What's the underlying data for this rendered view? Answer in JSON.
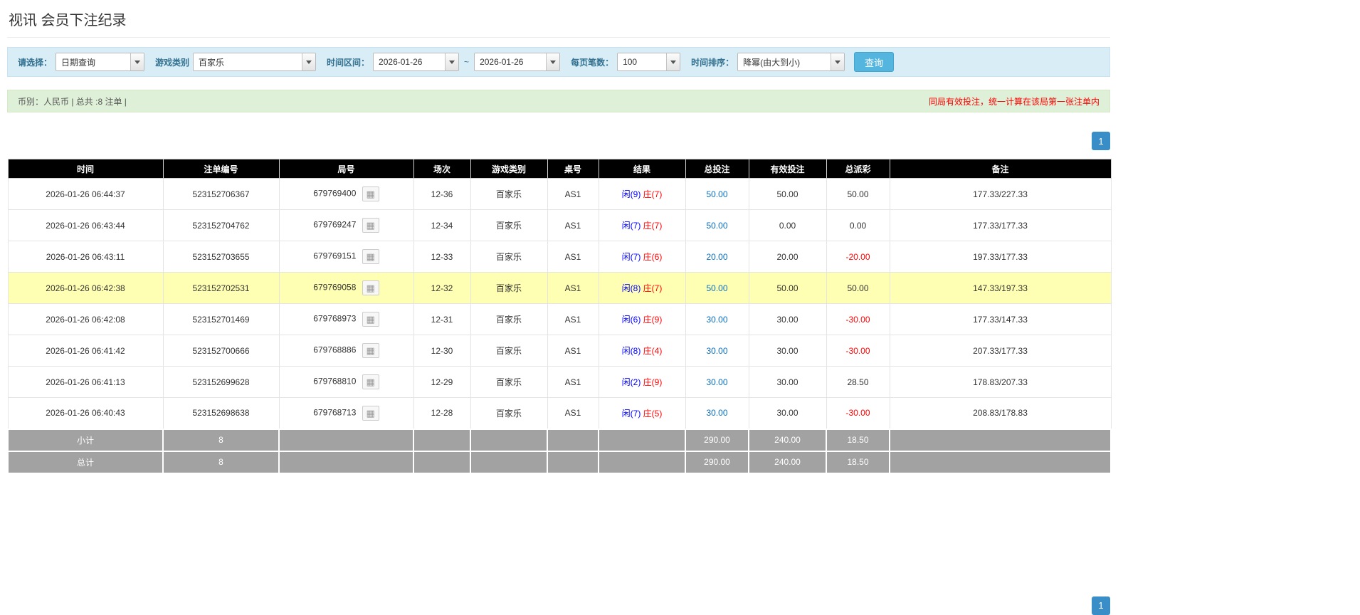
{
  "page": {
    "title": "视讯 会员下注纪录"
  },
  "filter": {
    "select_label": "请选择：",
    "select_value": "日期查询",
    "game_label": "游戏类别",
    "game_value": "百家乐",
    "range_label": "时间区间：",
    "date_from": "2026-01-26",
    "tilde": "~",
    "date_to": "2026-01-26",
    "per_page_label": "每页笔数：",
    "per_page_value": "100",
    "sort_label": "时间排序：",
    "sort_value": "降幂(由大到小)",
    "search_button": "查询"
  },
  "summary": {
    "left": "币别：人民币 | 总共 :8 注单 |",
    "right": "同局有效投注，统一计算在该局第一张注单内"
  },
  "pagination": {
    "page": "1"
  },
  "table": {
    "headers": [
      "时间",
      "注单编号",
      "局号",
      "场次",
      "游戏类别",
      "桌号",
      "结果",
      "总投注",
      "有效投注",
      "总派彩",
      "备注"
    ],
    "rows": [
      {
        "time": "2026-01-26 06:44:37",
        "bet_id": "523152706367",
        "round": "679769400",
        "session": "12-36",
        "game": "百家乐",
        "table": "AS1",
        "player": "闲(9)",
        "banker": "庄(7)",
        "total_bet": "50.00",
        "valid_bet": "50.00",
        "payout": "50.00",
        "payout_neg": false,
        "note": "177.33/227.33",
        "highlight": false
      },
      {
        "time": "2026-01-26 06:43:44",
        "bet_id": "523152704762",
        "round": "679769247",
        "session": "12-34",
        "game": "百家乐",
        "table": "AS1",
        "player": "闲(7)",
        "banker": "庄(7)",
        "total_bet": "50.00",
        "valid_bet": "0.00",
        "payout": "0.00",
        "payout_neg": false,
        "note": "177.33/177.33",
        "highlight": false
      },
      {
        "time": "2026-01-26 06:43:11",
        "bet_id": "523152703655",
        "round": "679769151",
        "session": "12-33",
        "game": "百家乐",
        "table": "AS1",
        "player": "闲(7)",
        "banker": "庄(6)",
        "total_bet": "20.00",
        "valid_bet": "20.00",
        "payout": "-20.00",
        "payout_neg": true,
        "note": "197.33/177.33",
        "highlight": false
      },
      {
        "time": "2026-01-26 06:42:38",
        "bet_id": "523152702531",
        "round": "679769058",
        "session": "12-32",
        "game": "百家乐",
        "table": "AS1",
        "player": "闲(8)",
        "banker": "庄(7)",
        "total_bet": "50.00",
        "valid_bet": "50.00",
        "payout": "50.00",
        "payout_neg": false,
        "note": "147.33/197.33",
        "highlight": true
      },
      {
        "time": "2026-01-26 06:42:08",
        "bet_id": "523152701469",
        "round": "679768973",
        "session": "12-31",
        "game": "百家乐",
        "table": "AS1",
        "player": "闲(6)",
        "banker": "庄(9)",
        "total_bet": "30.00",
        "valid_bet": "30.00",
        "payout": "-30.00",
        "payout_neg": true,
        "note": "177.33/147.33",
        "highlight": false
      },
      {
        "time": "2026-01-26 06:41:42",
        "bet_id": "523152700666",
        "round": "679768886",
        "session": "12-30",
        "game": "百家乐",
        "table": "AS1",
        "player": "闲(8)",
        "banker": "庄(4)",
        "total_bet": "30.00",
        "valid_bet": "30.00",
        "payout": "-30.00",
        "payout_neg": true,
        "note": "207.33/177.33",
        "highlight": false
      },
      {
        "time": "2026-01-26 06:41:13",
        "bet_id": "523152699628",
        "round": "679768810",
        "session": "12-29",
        "game": "百家乐",
        "table": "AS1",
        "player": "闲(2)",
        "banker": "庄(9)",
        "total_bet": "30.00",
        "valid_bet": "30.00",
        "payout": "28.50",
        "payout_neg": false,
        "note": "178.83/207.33",
        "highlight": false
      },
      {
        "time": "2026-01-26 06:40:43",
        "bet_id": "523152698638",
        "round": "679768713",
        "session": "12-28",
        "game": "百家乐",
        "table": "AS1",
        "player": "闲(7)",
        "banker": "庄(5)",
        "total_bet": "30.00",
        "valid_bet": "30.00",
        "payout": "-30.00",
        "payout_neg": true,
        "note": "208.83/178.83",
        "highlight": false
      }
    ],
    "subtotal": {
      "label": "小计",
      "count": "8",
      "total_bet": "290.00",
      "valid_bet": "240.00",
      "payout": "18.50"
    },
    "total": {
      "label": "总计",
      "count": "8",
      "total_bet": "290.00",
      "valid_bet": "240.00",
      "payout": "18.50"
    }
  },
  "colors": {
    "accent_blue": "#3a8ec8",
    "filter_bar_blue": "#d9edf7",
    "summary_green": "#dff0d8",
    "player_blue": "#0000ff",
    "banker_red": "#ff0000",
    "negative_red": "#ff0000",
    "highlight_yellow": "#ffffb3",
    "header_black": "#000000",
    "footer_gray": "#a2a2a2"
  },
  "icons": {
    "roadmap_icon": "▦"
  }
}
